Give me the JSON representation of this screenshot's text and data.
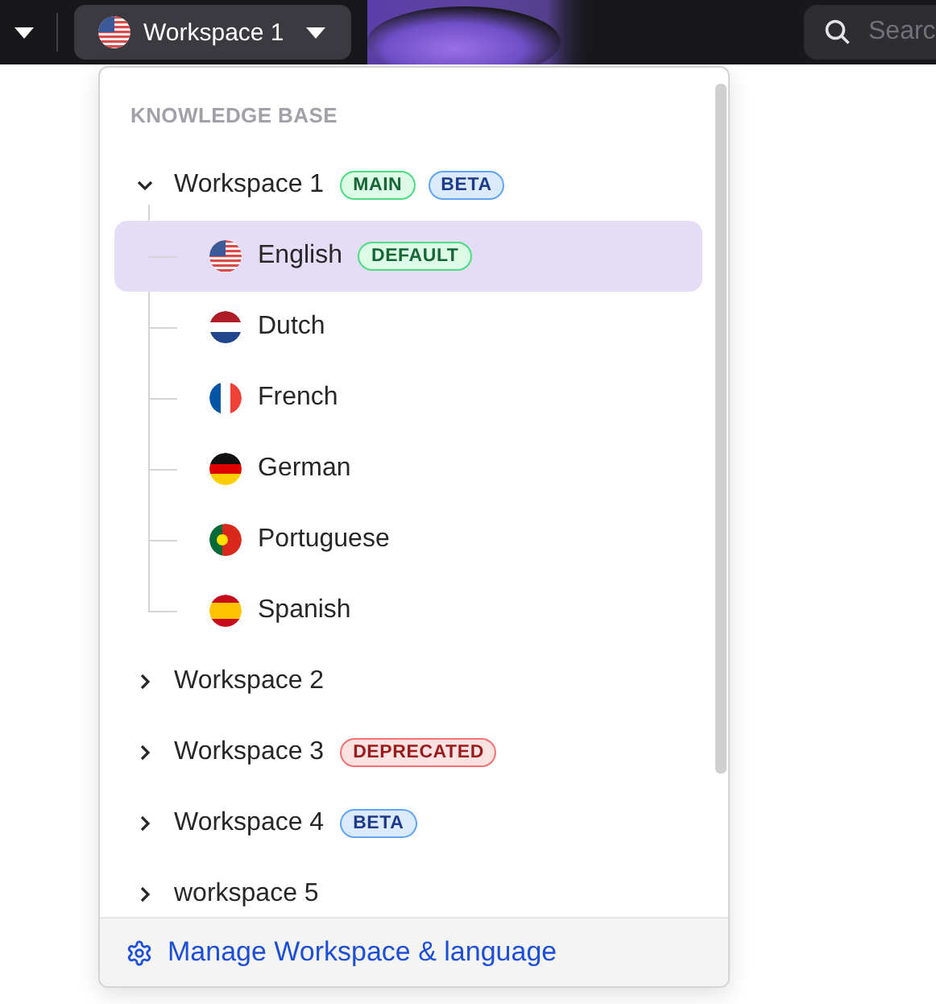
{
  "topbar": {
    "workspace_button": {
      "label": "Workspace 1"
    },
    "search": {
      "placeholder": "Searc"
    }
  },
  "dropdown": {
    "heading": "KNOWLEDGE BASE",
    "workspaces": [
      {
        "label": "Workspace 1",
        "expanded": true,
        "badges": [
          {
            "text": "MAIN",
            "kind": "main"
          },
          {
            "text": "BETA",
            "kind": "beta"
          }
        ],
        "children": [
          {
            "label": "English",
            "selected": true,
            "badges": [
              {
                "text": "DEFAULT",
                "kind": "main"
              }
            ]
          },
          {
            "label": "Dutch",
            "selected": false
          },
          {
            "label": "French",
            "selected": false
          },
          {
            "label": "German",
            "selected": false
          },
          {
            "label": "Portuguese",
            "selected": false
          },
          {
            "label": "Spanish",
            "selected": false
          }
        ]
      },
      {
        "label": "Workspace 2",
        "expanded": false
      },
      {
        "label": "Workspace 3",
        "expanded": false,
        "badges": [
          {
            "text": "DEPRECATED",
            "kind": "deprecated"
          }
        ]
      },
      {
        "label": "Workspace 4",
        "expanded": false,
        "badges": [
          {
            "text": "BETA",
            "kind": "beta"
          }
        ]
      },
      {
        "label": "workspace 5",
        "expanded": false
      }
    ],
    "footer_link": "Manage Workspace & language"
  }
}
